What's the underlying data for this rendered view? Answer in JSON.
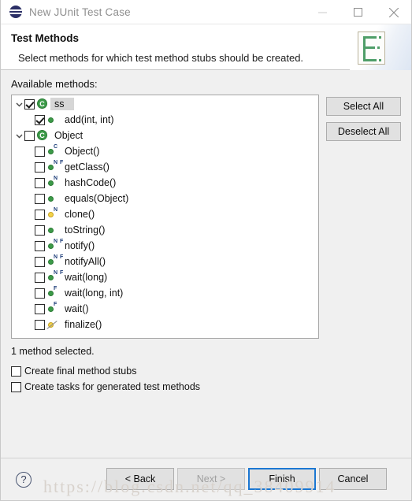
{
  "window": {
    "title": "New JUnit Test Case",
    "icon": "junit-icon",
    "controls": [
      {
        "name": "minimize-button",
        "glyph": "minimize-icon"
      },
      {
        "name": "maximize-button",
        "glyph": "maximize-icon"
      },
      {
        "name": "close-button",
        "glyph": "close-icon"
      }
    ]
  },
  "header": {
    "title": "Test Methods",
    "description": "Select methods for which test method stubs should be created.",
    "banner_icon": "junit-test-list-icon"
  },
  "main": {
    "available_label": "Available methods:",
    "status": "1 method selected.",
    "tree": [
      {
        "label": "ss",
        "level": 0,
        "checked": true,
        "expanded": true,
        "selected": true,
        "icon": "class-icon",
        "badges": ""
      },
      {
        "label": "add(int, int)",
        "level": 1,
        "checked": true,
        "expanded": null,
        "selected": false,
        "icon": "method-public-icon",
        "badges": ""
      },
      {
        "label": "Object",
        "level": 0,
        "checked": false,
        "expanded": true,
        "selected": false,
        "icon": "class-icon",
        "badges": ""
      },
      {
        "label": "Object()",
        "level": 1,
        "checked": false,
        "expanded": null,
        "selected": false,
        "icon": "method-public-icon",
        "badges": "C"
      },
      {
        "label": "getClass()",
        "level": 1,
        "checked": false,
        "expanded": null,
        "selected": false,
        "icon": "method-public-icon",
        "badges": "NF"
      },
      {
        "label": "hashCode()",
        "level": 1,
        "checked": false,
        "expanded": null,
        "selected": false,
        "icon": "method-public-icon",
        "badges": "N"
      },
      {
        "label": "equals(Object)",
        "level": 1,
        "checked": false,
        "expanded": null,
        "selected": false,
        "icon": "method-public-icon",
        "badges": ""
      },
      {
        "label": "clone()",
        "level": 1,
        "checked": false,
        "expanded": null,
        "selected": false,
        "icon": "method-protected-icon",
        "badges": "N"
      },
      {
        "label": "toString()",
        "level": 1,
        "checked": false,
        "expanded": null,
        "selected": false,
        "icon": "method-public-icon",
        "badges": ""
      },
      {
        "label": "notify()",
        "level": 1,
        "checked": false,
        "expanded": null,
        "selected": false,
        "icon": "method-public-icon",
        "badges": "NF"
      },
      {
        "label": "notifyAll()",
        "level": 1,
        "checked": false,
        "expanded": null,
        "selected": false,
        "icon": "method-public-icon",
        "badges": "NF"
      },
      {
        "label": "wait(long)",
        "level": 1,
        "checked": false,
        "expanded": null,
        "selected": false,
        "icon": "method-public-icon",
        "badges": "NF"
      },
      {
        "label": "wait(long, int)",
        "level": 1,
        "checked": false,
        "expanded": null,
        "selected": false,
        "icon": "method-public-icon",
        "badges": "F"
      },
      {
        "label": "wait()",
        "level": 1,
        "checked": false,
        "expanded": null,
        "selected": false,
        "icon": "method-public-icon",
        "badges": "F"
      },
      {
        "label": "finalize()",
        "level": 1,
        "checked": false,
        "expanded": null,
        "selected": false,
        "icon": "method-deprecated-icon",
        "badges": ""
      }
    ],
    "side_buttons": [
      {
        "name": "select-all-button",
        "label": "Select All"
      },
      {
        "name": "deselect-all-button",
        "label": "Deselect All"
      }
    ],
    "options": [
      {
        "name": "create-final-method-stubs-checkbox",
        "label": "Create final method stubs",
        "checked": false
      },
      {
        "name": "create-tasks-checkbox",
        "label": "Create tasks for generated test methods",
        "checked": false
      }
    ]
  },
  "footer": {
    "help": "?",
    "buttons": [
      {
        "name": "back-button",
        "label": "< Back",
        "state": "normal"
      },
      {
        "name": "next-button",
        "label": "Next >",
        "state": "disabled"
      },
      {
        "name": "finish-button",
        "label": "Finish",
        "state": "default"
      },
      {
        "name": "cancel-button",
        "label": "Cancel",
        "state": "normal"
      }
    ]
  },
  "watermark": "https://blog.csdn.net/qq_38409914",
  "colors": {
    "accent": "#1b77d2",
    "class_icon": "#3c9a48",
    "protected_icon": "#f2d24a",
    "banner_green": "#4f9e68",
    "junit_navy": "#2b2f66"
  }
}
